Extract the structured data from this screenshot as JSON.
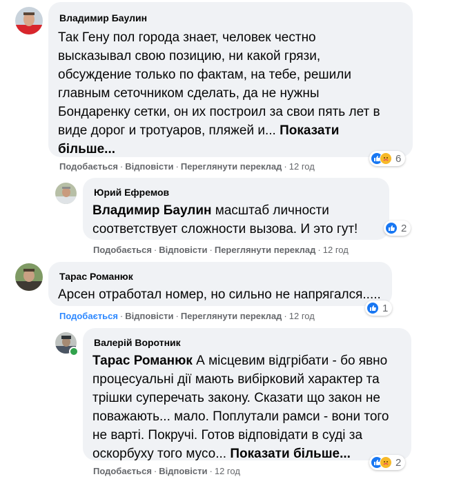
{
  "comments": [
    {
      "author": "Владимир Баулин",
      "mention": "",
      "lines": [
        "Так Гену пол города знает, человек честно",
        "высказывал свою позицию, ни какой грязи,",
        "обсуждение только по фактам, на тебе, решили",
        "главным сеточником сделать, да не нужны",
        "Бондаренку сетки, он их построил за свои пять лет в",
        "виде дорог и тротуаров, пляжей и... "
      ],
      "more": "Показати",
      "more_line2": "більше...",
      "actions": {
        "like": "Подобається",
        "reply": "Відповісти",
        "translate": "Переглянути переклад",
        "time": "12 год"
      },
      "reaction_count": "6",
      "reactions": [
        "like-icon",
        "care-icon"
      ]
    },
    {
      "author": "Юрий Ефремов",
      "mention": "Владимир Баулин",
      "lines": [
        " масштаб личности",
        "соответствует сложности вызова. И это гут!"
      ],
      "actions": {
        "like": "Подобається",
        "reply": "Відповісти",
        "translate": "Переглянути переклад",
        "time": "12 год"
      },
      "reaction_count": "2",
      "reactions": [
        "like-icon"
      ]
    },
    {
      "author": "Тарас Романюк",
      "mention": "",
      "lines": [
        "Арсен отработал номер, но сильно не напрягался....."
      ],
      "actions": {
        "like": "Подобається",
        "reply": "Відповісти",
        "translate": "Переглянути переклад",
        "time": "12 год"
      },
      "reaction_count": "1",
      "reactions": [
        "like-icon"
      ]
    },
    {
      "author": "Валерій Воротник",
      "mention": "Тарас Романюк",
      "lines": [
        " А місцевим відгрібати - бо явно",
        "процесуальні дії мають вибірковий характер та",
        "трішки суперечать закону. Сказати що закон не",
        "поважають... мало. Поплутали рамси - вони того",
        "не варті. Покручі. Готов відповідати в суді за",
        "оскорбуху того мусо... "
      ],
      "more": "Показати більше...",
      "actions": {
        "like": "Подобається",
        "reply": "Відповісти",
        "time": "12 год"
      },
      "reaction_count": "2",
      "reactions": [
        "like-icon",
        "care-icon"
      ]
    }
  ],
  "colors": {
    "bubble": "#f0f2f5",
    "link_active": "#2d88ff",
    "muted": "#65676b",
    "like": "#1877f2",
    "care": "#f7b928",
    "online": "#31a24c"
  }
}
